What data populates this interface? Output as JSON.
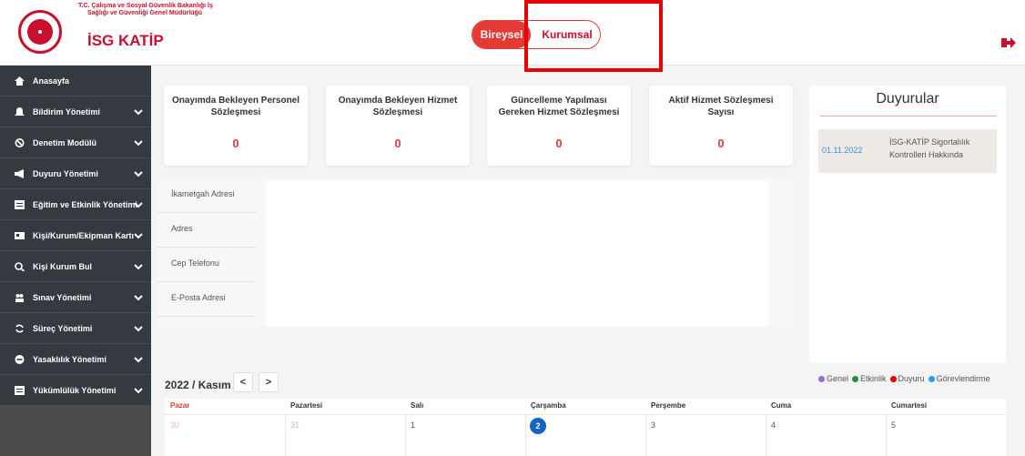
{
  "header": {
    "ministry_line1": "T.C. Çalışma ve Sosyal Güvenlik Bakanlığı İş",
    "ministry_line2": "Sağlığı ve Güvenliği Genel Müdürlüğü",
    "app_title": "İSG KATİP",
    "toggle": {
      "bireysel": "Bireysel",
      "kurumsal": "Kurumsal"
    },
    "exit_icon": "sign-out-icon"
  },
  "colors": {
    "brand": "#c8102e",
    "accent": "#e53935",
    "sidebar": "#343a40",
    "link": "#3d8fdf",
    "today": "#1565c0"
  },
  "sidebar": {
    "items": [
      {
        "label": "Anasayfa",
        "icon": "home-icon"
      },
      {
        "label": "Bildirim Yönetimi",
        "icon": "bell-icon"
      },
      {
        "label": "Denetim Modülü",
        "icon": "ban-icon"
      },
      {
        "label": "Duyuru Yönetimi",
        "icon": "bullhorn-icon"
      },
      {
        "label": "Eğitim ve Etkinlik Yönetimi",
        "icon": "list-alt-icon"
      },
      {
        "label": "Kişi/Kurum/Ekipman Kartı",
        "icon": "id-card-icon"
      },
      {
        "label": "Kişi Kurum Bul",
        "icon": "search-plus-icon"
      },
      {
        "label": "Sınav Yönetimi",
        "icon": "users-icon"
      },
      {
        "label": "Süreç Yönetimi",
        "icon": "sync-icon"
      },
      {
        "label": "Yasaklılık Yönetimi",
        "icon": "minus-circle-icon"
      },
      {
        "label": "Yükümlülük Yönetimi",
        "icon": "list-alt-icon"
      }
    ]
  },
  "cards": [
    {
      "title": "Onayımda Bekleyen Personel Sözleşmesi",
      "value": "0"
    },
    {
      "title": "Onayımda Bekleyen Hizmet Sözleşmesi",
      "value": "0"
    },
    {
      "title": "Güncelleme Yapılması Gereken Hizmet Sözleşmesi",
      "value": "0"
    },
    {
      "title": "Aktif Hizmet Sözleşmesi Sayısı",
      "value": "0"
    }
  ],
  "announcements": {
    "title": "Duyurular",
    "items": [
      {
        "date": "01.11.2022",
        "text": "İSG-KATİP Sigortalılık Kontrolleri Hakkında"
      }
    ]
  },
  "profile": {
    "rows": [
      "İkametgah Adresi",
      "Adres",
      "Cep Telefonu",
      "E-Posta Adresi"
    ]
  },
  "legend": [
    {
      "label": "Genel",
      "color": "#9c6ade"
    },
    {
      "label": "Etkinlik",
      "color": "#1e8e3e"
    },
    {
      "label": "Duyuru",
      "color": "#e60000"
    },
    {
      "label": "Görevlendirme",
      "color": "#1ea1f2"
    }
  ],
  "calendar": {
    "title": "2022 / Kasım",
    "prev": "<",
    "next": ">",
    "days": [
      "Pazar",
      "Pazartesi",
      "Salı",
      "Çarşamba",
      "Perşembe",
      "Cuma",
      "Cumartesi"
    ],
    "dates": [
      "30",
      "31",
      "1",
      "2",
      "3",
      "4",
      "5"
    ],
    "today": "2"
  }
}
